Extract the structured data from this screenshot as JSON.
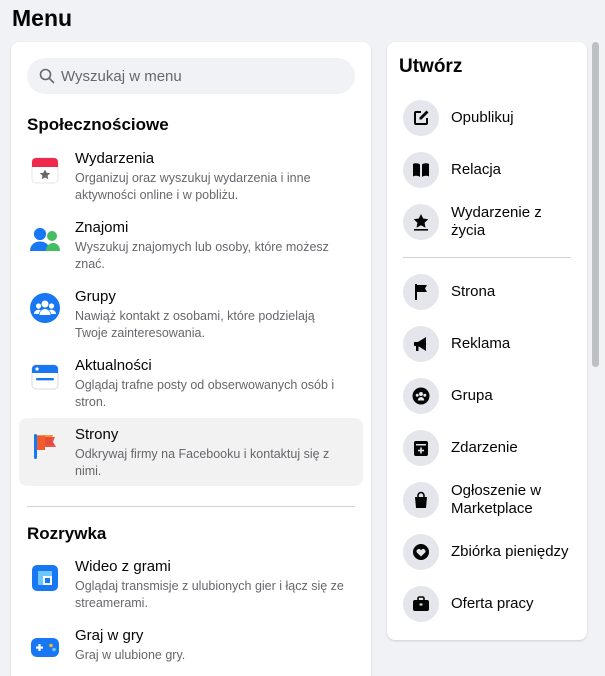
{
  "page_title": "Menu",
  "search": {
    "placeholder": "Wyszukaj w menu"
  },
  "sections": [
    {
      "title": "Społecznościowe",
      "items": [
        {
          "name": "Wydarzenia",
          "desc": "Organizuj oraz wyszukuj wydarzenia i inne aktywności online i w pobliżu.",
          "icon": "calendar-icon"
        },
        {
          "name": "Znajomi",
          "desc": "Wyszukuj znajomych lub osoby, które możesz znać.",
          "icon": "friends-icon"
        },
        {
          "name": "Grupy",
          "desc": "Nawiąż kontakt z osobami, które podzielają Twoje zainteresowania.",
          "icon": "groups-icon"
        },
        {
          "name": "Aktualności",
          "desc": "Oglądaj trafne posty od obserwowanych osób i stron.",
          "icon": "news-feed-icon"
        },
        {
          "name": "Strony",
          "desc": "Odkrywaj firmy na Facebooku i kontaktuj się z nimi.",
          "icon": "pages-flag-icon"
        }
      ]
    },
    {
      "title": "Rozrywka",
      "items": [
        {
          "name": "Wideo z grami",
          "desc": "Oglądaj transmisje z ulubionych gier i łącz się ze streamerami.",
          "icon": "gaming-video-icon"
        },
        {
          "name": "Graj w gry",
          "desc": "Graj w ulubione gry.",
          "icon": "gamepad-icon"
        }
      ]
    }
  ],
  "create": {
    "title": "Utwórz",
    "items": [
      {
        "label": "Opublikuj",
        "icon": "compose-icon"
      },
      {
        "label": "Relacja",
        "icon": "story-book-icon"
      },
      {
        "label": "Wydarzenie z życia",
        "icon": "life-event-star-icon"
      },
      {
        "label": "Strona",
        "icon": "page-flag-icon"
      },
      {
        "label": "Reklama",
        "icon": "megaphone-icon"
      },
      {
        "label": "Grupa",
        "icon": "group-icon"
      },
      {
        "label": "Zdarzenie",
        "icon": "event-calendar-icon"
      },
      {
        "label": "Ogłoszenie w Marketplace",
        "icon": "marketplace-bag-icon"
      },
      {
        "label": "Zbiórka pieniędzy",
        "icon": "fundraiser-heart-icon"
      },
      {
        "label": "Oferta pracy",
        "icon": "briefcase-icon"
      }
    ]
  }
}
